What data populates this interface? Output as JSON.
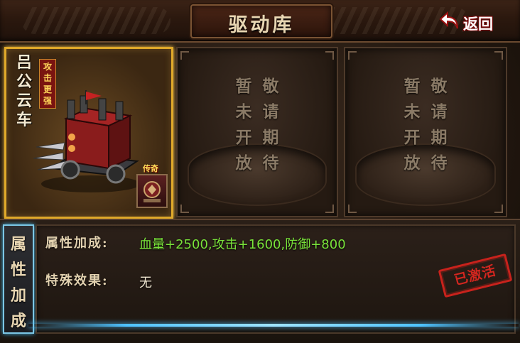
{
  "header": {
    "title": "驱动库",
    "back_label": "返回"
  },
  "cards": [
    {
      "name": "吕公云车",
      "tag": "攻击更强",
      "rarity": "传奇",
      "state": "active"
    },
    {
      "state": "locked",
      "lines": [
        "敬请期待",
        "暂未开放"
      ]
    },
    {
      "state": "locked",
      "lines": [
        "敬请期待",
        "暂未开放"
      ]
    }
  ],
  "attributes": {
    "side_label": "属性加成",
    "bonus_label": "属性加成:",
    "bonus_value": "血量+2500,攻击+1600,防御+800",
    "effect_label": "特殊效果:",
    "effect_value": "无",
    "stamp": "已激活"
  },
  "colors": {
    "gold_border": "#e0a92a",
    "green_value": "#79e23a",
    "stamp_red": "#c8221c",
    "glow_blue": "#4ec2ff"
  }
}
